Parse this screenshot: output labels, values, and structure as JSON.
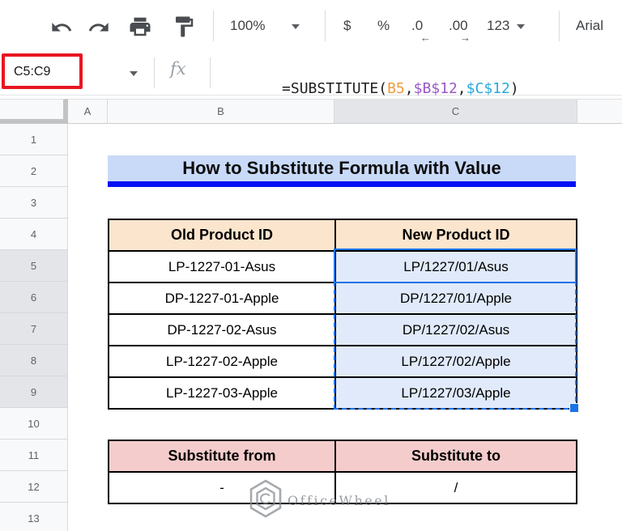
{
  "toolbar": {
    "zoom_value": "100%",
    "currency_label": "$",
    "percent_label": "%",
    "decrease_decimal_label": ".0",
    "decrease_decimal_arrow": "←",
    "increase_decimal_label": ".00",
    "increase_decimal_arrow": "→",
    "number_format_label": "123",
    "font_family_value": "Arial"
  },
  "formula_bar": {
    "name_box_value": "C5:C9",
    "fx_label": "fx",
    "annotation_color": "#e81620",
    "formula": [
      {
        "text": "=SUBSTITUTE(",
        "color": "#1f1f1f"
      },
      {
        "text": "B5",
        "color": "#ef9b3c"
      },
      {
        "text": ",",
        "color": "#1f1f1f"
      },
      {
        "text": "$B$12",
        "color": "#9a57c6"
      },
      {
        "text": ",",
        "color": "#1f1f1f"
      },
      {
        "text": "$C$12",
        "color": "#29a8dc"
      },
      {
        "text": ")",
        "color": "#1f1f1f"
      }
    ]
  },
  "grid": {
    "column_headers": [
      {
        "label": "A",
        "selected": false
      },
      {
        "label": "B",
        "selected": false
      },
      {
        "label": "C",
        "selected": true
      }
    ],
    "row_headers": [
      {
        "label": "1",
        "selected": false
      },
      {
        "label": "2",
        "selected": false
      },
      {
        "label": "3",
        "selected": false
      },
      {
        "label": "4",
        "selected": false
      },
      {
        "label": "5",
        "selected": true
      },
      {
        "label": "6",
        "selected": true
      },
      {
        "label": "7",
        "selected": true
      },
      {
        "label": "8",
        "selected": true
      },
      {
        "label": "9",
        "selected": true
      },
      {
        "label": "10",
        "selected": false
      },
      {
        "label": "11",
        "selected": false
      },
      {
        "label": "12",
        "selected": false
      },
      {
        "label": "13",
        "selected": false
      }
    ]
  },
  "sheet": {
    "title": {
      "text": "How to Substitute Formula with Value",
      "bg_color": "#c9daf8",
      "underline_color": "#0511f2"
    },
    "product_table": {
      "headers": [
        "Old Product ID",
        "New Product ID"
      ],
      "header_bg": "#fce5cd",
      "selection_fill": "#e0eafa",
      "selection_border_color": "#1a73e8",
      "rows": [
        [
          "LP-1227-01-Asus",
          "LP/1227/01/Asus"
        ],
        [
          "DP-1227-01-Apple",
          "DP/1227/01/Apple"
        ],
        [
          "DP-1227-02-Asus",
          "DP/1227/02/Asus"
        ],
        [
          "LP-1227-02-Apple",
          "LP/1227/02/Apple"
        ],
        [
          "LP-1227-03-Apple",
          "LP/1227/03/Apple"
        ]
      ]
    },
    "substitute_table": {
      "headers": [
        "Substitute from",
        "Substitute to"
      ],
      "header_bg": "#f4cccc",
      "rows": [
        [
          "-",
          "/"
        ]
      ]
    },
    "watermark_text": "OfficeWheel"
  }
}
